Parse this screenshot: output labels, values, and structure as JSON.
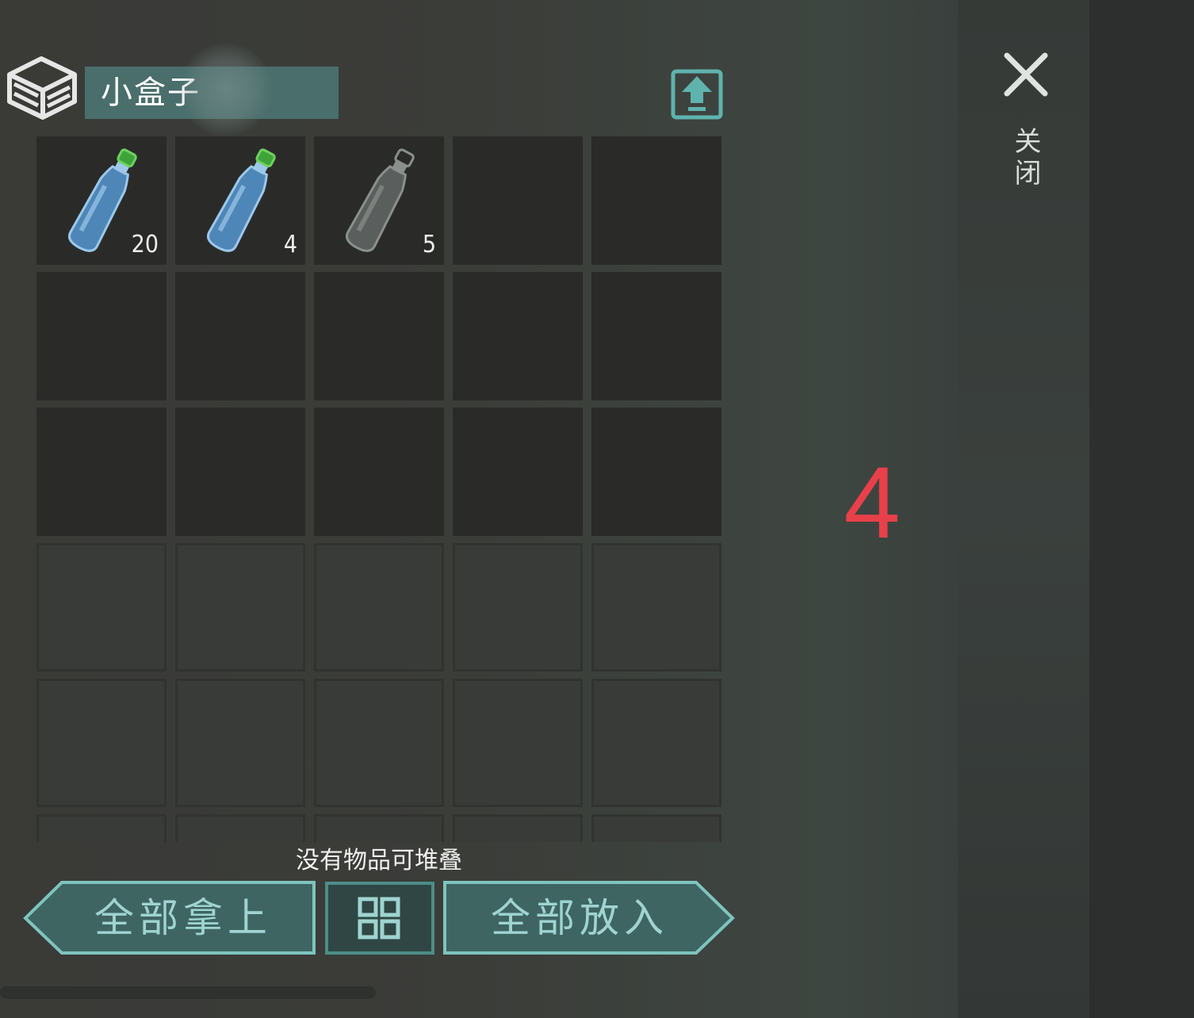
{
  "container": {
    "title": "小盒子",
    "slots": [
      {
        "item": "water-bottle",
        "quantity": "20"
      },
      {
        "item": "water-bottle",
        "quantity": "4"
      },
      {
        "item": "empty-bottle",
        "quantity": "5"
      }
    ]
  },
  "status": {
    "message": "没有物品可堆叠"
  },
  "actions": {
    "take_all": "全部拿上",
    "put_all": "全部放入"
  },
  "close": {
    "label": "关闭"
  },
  "overlay": {
    "marker": "4"
  },
  "icons": {
    "box": "box-icon",
    "export": "export-icon",
    "close": "close-icon",
    "sort": "grid-sort-icon"
  },
  "colors": {
    "accent": "#4a6e6b",
    "button_text": "#9fd4d0",
    "marker": "#e8404a"
  }
}
